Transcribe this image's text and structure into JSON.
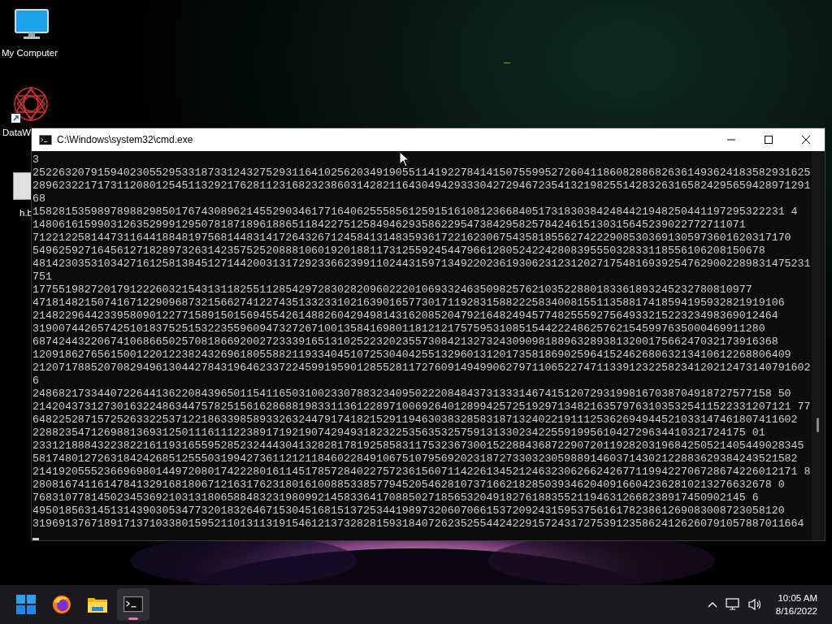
{
  "desktop_icons": [
    {
      "label": "My Computer",
      "kind": "computer"
    },
    {
      "label": "DataW",
      "kind": "mandala"
    },
    {
      "label": "h.b",
      "kind": "file"
    }
  ],
  "window": {
    "title": "C:\\Windows\\system32\\cmd.exe",
    "lines": [
      "3",
      "252263207915940230552953318733124327529311641025620349190551141922784141507559952726041186082886826361493624183582931625",
      "289623221717311208012545113292176281123168232386031428211643049429333042729467235413219825514283263165824295659428971291",
      "68",
      "15828153598978988298501767430896214552903461771640625558561259151610812366840517318303842484421948250441197295322231 4",
      "14806161599031263529991295078187189618865118422751258494629358622954738429582578424615130315645239022772711071",
      "712212258144731164418848197568144831417264326712458413148359361722162306754358185562742229085303691305973601620317170",
      "54962592716456127182897326314235752520888106019201881173125592454479661280524224280839555032833118556106208150678",
      "481423035310342716125813845127144200313172923366239911024431597134922023619306231231202717548169392547629002289831475231",
      "751",
      "177551982720179122260321543131182551128542972830282096022201069332463509825762103522880183361893245232780810977",
      "47181482150741671229096873215662741227435133233102163901657730171192831588222583400815511358817418594195932821919106",
      "2148229644233958090122771589150156945542614882604294981431620852047921648249457748255592756493321522323498369012464",
      "31900744265742510183752515322355960947327267100135841698011812121757595310851544222486257621545997635000469911280",
      "6874244322067410686650257081866920027233391651310252232023557308421327324309098188963289381320017566247032173916368",
      "120918627656150012201223824326961805588211933404510725304042551329601312017358186902596415246268063213410612268806409",
      "212071788520708294961304427843196462337224599195901285528117276091494990627971106522747113391232258234120212473140791602",
      "6",
      "248682173344072264413622084396501154116503100233078832340950222084843731333146741512072931998167038704918727577158 50",
      "214204373127301632248634475782515616286881983311361228971006926401289942572519297134821635797631035325411522331207121 77",
      "6482252871572526332253712218633985893326324479174182152911946303832858318713240221911125362694944521033147461807411602",
      "22882354712698813693125011161112238917192190742949318232253563532575913133023422559199561042729634410321724175 01",
      "23312188843223822161193165595285232444304132828178192585831175323673001522884368722907201192820319684250521405449028345",
      "5817480127263184242685125550319942736112121184602284910675107956920231872733032305988914603714302122883629384243521582",
      "2141920555236696980144972080174222801611451785728402275723615607114226134521246323062662426771199422706728674226012171 8",
      "280816741161478413291681806712163176231801610088533857794520546281073716621828503934620409166042362810213276632678 0",
      "76831077814502345369210313180658848323198099214583364170885027185653204918276188355211946312668238917450902145 6",
      "49501856314513143903053477320183264671530451681513725344198973206070661537209243159537561617823861269083008723058120",
      "31969137671891713710338015952110131131915461213732828159318407262352554424229157243172753912358624126260791057887011664"
    ]
  },
  "taskbar": {
    "apps": [
      {
        "kind": "start",
        "selected": false
      },
      {
        "kind": "browser",
        "selected": false
      },
      {
        "kind": "folder",
        "selected": false
      },
      {
        "kind": "terminal",
        "selected": true
      }
    ],
    "clock": {
      "time": "10:05 AM",
      "date": "8/16/2022"
    }
  }
}
